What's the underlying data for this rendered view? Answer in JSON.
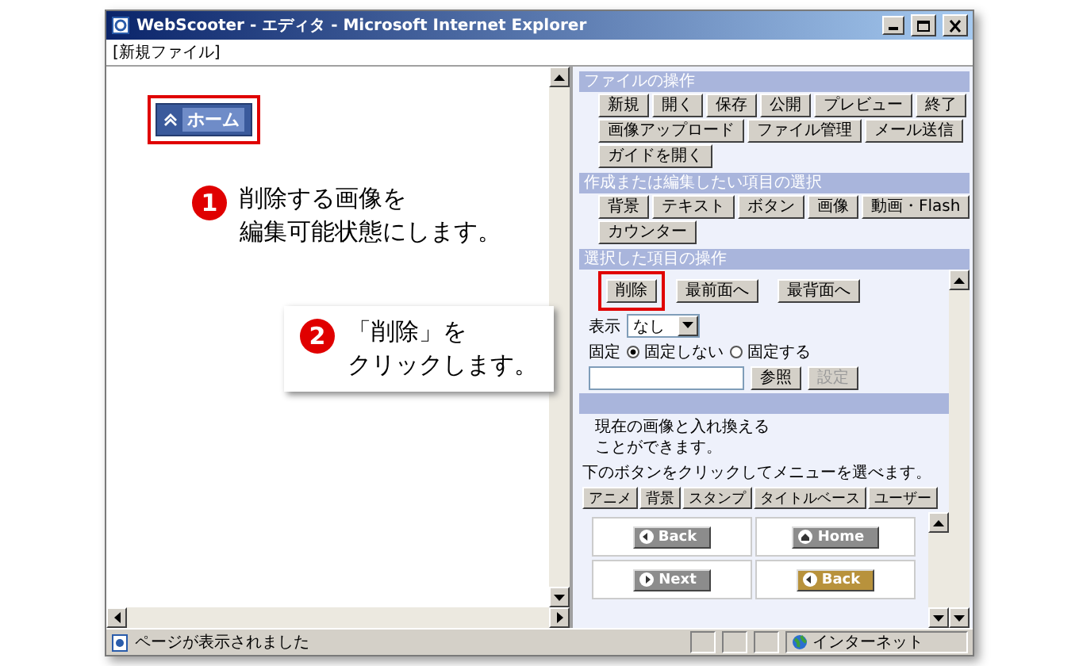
{
  "window": {
    "title": "WebScooter - エディタ - Microsoft Internet Explorer"
  },
  "file_label": "[新規ファイル]",
  "editor": {
    "home_button": {
      "label": "ホーム",
      "highlighted": true
    }
  },
  "steps": [
    {
      "number": "1",
      "lines": [
        "削除する画像を",
        "編集可能状態にします。"
      ]
    },
    {
      "number": "2",
      "lines": [
        "「削除」を",
        "クリックします。"
      ]
    }
  ],
  "panel": {
    "sections": [
      {
        "title": "ファイルの操作",
        "button_rows": [
          [
            "新規",
            "開く",
            "保存",
            "公開",
            "プレビュー",
            "終了"
          ],
          [
            "画像アップロード",
            "ファイル管理",
            "メール送信"
          ],
          [
            "ガイドを開く"
          ]
        ]
      },
      {
        "title": "作成または編集したい項目の選択",
        "button_rows": [
          [
            "背景",
            "テキスト",
            "ボタン",
            "画像",
            "動画・Flash"
          ],
          [
            "カウンター"
          ]
        ]
      }
    ],
    "item_operations": {
      "title": "選択した項目の操作",
      "buttons": [
        {
          "label": "削除",
          "highlighted": true
        },
        {
          "label": "最前面へ",
          "highlighted": false
        },
        {
          "label": "最背面へ",
          "highlighted": false
        }
      ],
      "display": {
        "label": "表示",
        "value": "なし"
      },
      "fixed": {
        "label": "固定",
        "options": [
          {
            "label": "固定しない",
            "selected": true
          },
          {
            "label": "固定する",
            "selected": false
          }
        ]
      },
      "file_buttons": [
        {
          "label": "参照",
          "disabled": false
        },
        {
          "label": "設定",
          "disabled": true
        }
      ],
      "replace_note": [
        "現在の画像と入れ換える",
        "ことができます。"
      ]
    },
    "gallery": {
      "instruction": "下のボタンをクリックしてメニューを選べます。",
      "tabs": [
        "アニメ",
        "背景",
        "スタンプ",
        "タイトルベース",
        "ユーザー"
      ],
      "items": [
        {
          "kind": "back",
          "label": "Back",
          "color": "#8c8c8c"
        },
        {
          "kind": "home",
          "label": "Home",
          "color": "#8c8c8c"
        },
        {
          "kind": "next",
          "label": "Next",
          "color": "#8c8c8c"
        },
        {
          "kind": "back",
          "label": "Back",
          "color": "#b8923c"
        }
      ]
    }
  },
  "status_bar": {
    "message": "ページが表示されました",
    "zone": "インターネット"
  }
}
